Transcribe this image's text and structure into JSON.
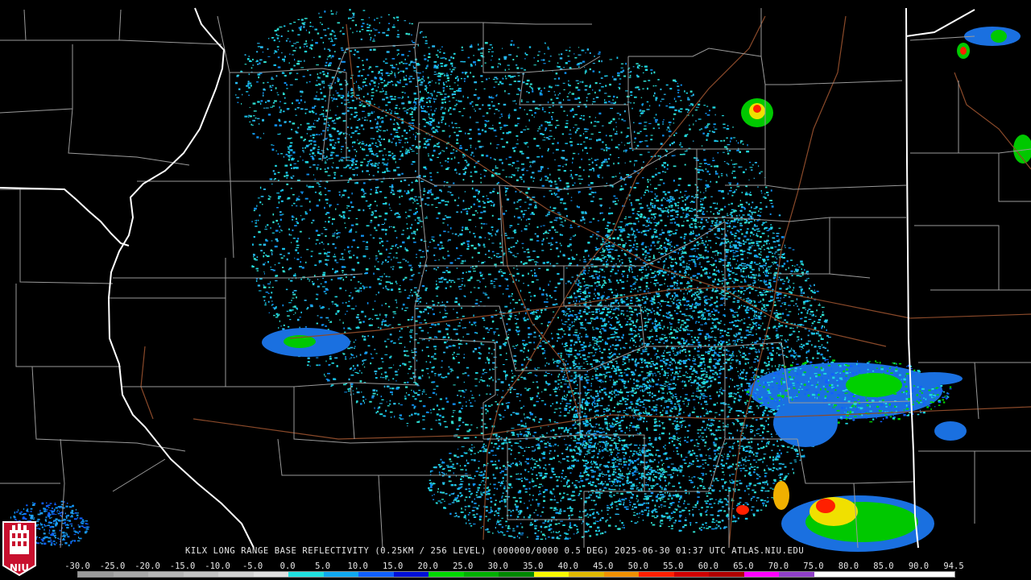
{
  "caption": "KILX LONG RANGE BASE REFLECTIVITY (0.25KM / 256 LEVEL) (000000/0000 0.5 DEG) 2025-06-30 01:37 UTC  ATLAS.NIU.EDU",
  "logo": {
    "text": "NIU",
    "color": "#c8102e"
  },
  "scale": {
    "labels": [
      "-30.0",
      "-25.0",
      "-20.0",
      "-15.0",
      "-10.0",
      "-5.0",
      "0.0",
      "5.0",
      "10.0",
      "15.0",
      "20.0",
      "25.0",
      "30.0",
      "35.0",
      "40.0",
      "45.0",
      "50.0",
      "55.0",
      "60.0",
      "65.0",
      "70.0",
      "75.0",
      "80.0",
      "85.0",
      "90.0",
      "94.5"
    ],
    "colors": [
      "#9a9a9a",
      "#a8a8a8",
      "#b6b6b6",
      "#c4c4c4",
      "#d2d2d2",
      "#e0e0e0",
      "#20e0e0",
      "#10a8f0",
      "#1060ff",
      "#0010d8",
      "#00d800",
      "#00b000",
      "#008800",
      "#f8f800",
      "#e0b800",
      "#f09000",
      "#ff2000",
      "#d00000",
      "#b00000",
      "#ff00ff",
      "#9040c8",
      "#ffffff",
      "#ffffff",
      "#ffffff",
      "#ffffff"
    ]
  },
  "map_colors": {
    "background": "#000000",
    "county": "#9a9a9a",
    "state": "#ffffff",
    "road": "#8b4a2a"
  }
}
